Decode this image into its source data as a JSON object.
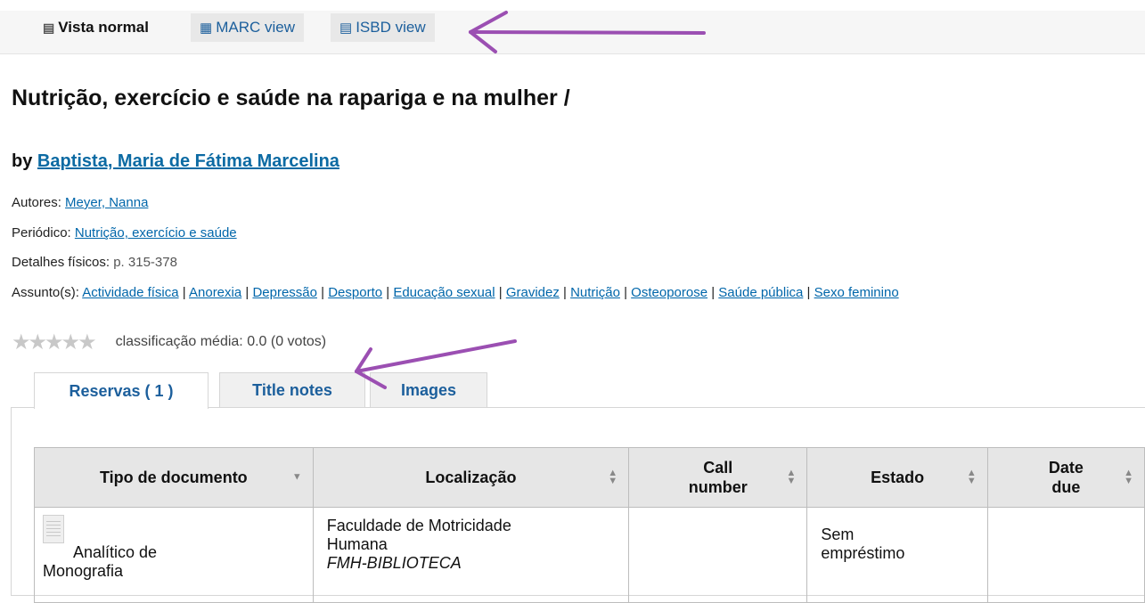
{
  "view_tabs": [
    {
      "label": "Vista normal",
      "icon": "document-icon"
    },
    {
      "label": "MARC view",
      "icon": "table-icon"
    },
    {
      "label": "ISBD view",
      "icon": "list-icon"
    }
  ],
  "record": {
    "title": "Nutrição, exercício e saúde na rapariga e na mulher /",
    "by_prefix": "by",
    "author": "Baptista, Maria de Fátima Marcelina",
    "authors_label": "Autores:",
    "authors_value": "Meyer, Nanna",
    "periodico_label": "Periódico:",
    "periodico_value": "Nutrição, exercício e saúde",
    "physical_label": "Detalhes físicos:",
    "physical_value": "p. 315-378",
    "subjects_label": "Assunto(s):",
    "subjects": [
      "Actividade física",
      "Anorexia",
      "Depressão",
      "Desporto",
      "Educação sexual",
      "Gravidez",
      "Nutrição",
      "Osteoporose",
      "Saúde pública",
      "Sexo feminino"
    ],
    "subjects_separator": " | "
  },
  "rating": {
    "text": "classificação média: 0.0 (0 votos)",
    "stars_filled": 0,
    "stars_total": 5
  },
  "record_tabs": [
    {
      "label": "Reservas ( 1 )",
      "active": true
    },
    {
      "label": "Title notes",
      "active": false
    },
    {
      "label": "Images",
      "active": false
    }
  ],
  "holdings": {
    "headers": [
      "Tipo de documento",
      "Localização",
      "Call number",
      "Estado",
      "Date due"
    ],
    "header_lines": [
      [
        "Tipo de documento"
      ],
      [
        "Localização"
      ],
      [
        "Call",
        "number"
      ],
      [
        "Estado"
      ],
      [
        "Date",
        "due"
      ]
    ],
    "rows": [
      {
        "tipo_line1": "Analítico de",
        "tipo_line2": "Monografia",
        "localizacao_line1": "Faculdade de Motricidade",
        "localizacao_line2": "Humana",
        "localizacao_branch": "FMH-BIBLIOTECA",
        "call_number": "",
        "estado_line1": "Sem",
        "estado_line2": "empréstimo",
        "date_due": ""
      }
    ]
  },
  "colors": {
    "link": "#0066aa",
    "tab_text": "#1c5f9c",
    "annotation_arrow": "#9b4fb2",
    "header_bg": "#e6e6e6"
  }
}
